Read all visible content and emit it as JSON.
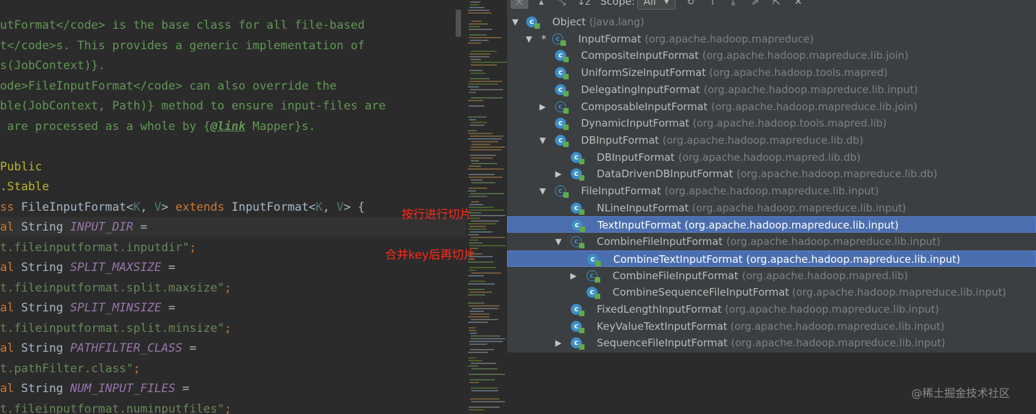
{
  "editor": {
    "lines": [
      [
        [
          "c-doc",
          "utFormat</code> is the base class for all file-based"
        ]
      ],
      [
        [
          "c-doc",
          "t</code>s. This provides a generic implementation of"
        ]
      ],
      [
        [
          "c-doc",
          "s(JobContext)}."
        ]
      ],
      [
        [
          "c-doc",
          "ode>FileInputFormat</code> can also override the"
        ]
      ],
      [
        [
          "c-doc",
          "ble(JobContext, Path)} method to ensure input-files are"
        ]
      ],
      [
        [
          "c-doc",
          " are processed as a whole by {"
        ],
        [
          "c-tag",
          "@link"
        ],
        [
          "c-doc",
          " Mapper}s."
        ]
      ],
      [
        [
          "c-def",
          ""
        ]
      ],
      [
        [
          "c-ann",
          "Public"
        ]
      ],
      [
        [
          "c-ann",
          ".Stable"
        ]
      ],
      [
        [
          "c-kw",
          "ss "
        ],
        [
          "c-def",
          "FileInputFormat<"
        ],
        [
          "c-tp",
          "K"
        ],
        [
          "c-def",
          ", "
        ],
        [
          "c-tp",
          "V"
        ],
        [
          "c-def",
          "> "
        ],
        [
          "c-kw",
          "extends "
        ],
        [
          "c-def",
          "InputFormat<"
        ],
        [
          "c-tp",
          "K"
        ],
        [
          "c-def",
          ", "
        ],
        [
          "c-tp",
          "V"
        ],
        [
          "c-def",
          "> {"
        ]
      ],
      [
        [
          "c-kw",
          "al "
        ],
        [
          "c-def",
          "String "
        ],
        [
          "c-cst",
          "INPUT_DIR"
        ],
        [
          "c-def",
          " ="
        ]
      ],
      [
        [
          "c-str",
          "t.fileinputformat.inputdir\""
        ],
        [
          "c-kw",
          ";"
        ]
      ],
      [
        [
          "c-kw",
          "al "
        ],
        [
          "c-def",
          "String "
        ],
        [
          "c-cst",
          "SPLIT_MAXSIZE"
        ],
        [
          "c-def",
          " ="
        ]
      ],
      [
        [
          "c-str",
          "t.fileinputformat.split.maxsize\""
        ],
        [
          "c-kw",
          ";"
        ]
      ],
      [
        [
          "c-kw",
          "al "
        ],
        [
          "c-def",
          "String "
        ],
        [
          "c-cst",
          "SPLIT_MINSIZE"
        ],
        [
          "c-def",
          " ="
        ]
      ],
      [
        [
          "c-str",
          "t.fileinputformat.split.minsize\""
        ],
        [
          "c-kw",
          ";"
        ]
      ],
      [
        [
          "c-kw",
          "al "
        ],
        [
          "c-def",
          "String "
        ],
        [
          "c-cst",
          "PATHFILTER_CLASS"
        ],
        [
          "c-def",
          " ="
        ]
      ],
      [
        [
          "c-str",
          "t.pathFilter.class\""
        ],
        [
          "c-kw",
          ";"
        ]
      ],
      [
        [
          "c-kw",
          "al "
        ],
        [
          "c-def",
          "String "
        ],
        [
          "c-cst",
          "NUM_INPUT_FILES"
        ],
        [
          "c-def",
          " ="
        ]
      ],
      [
        [
          "c-str",
          "t.fileinputformat.numinputfiles\""
        ],
        [
          "c-kw",
          ";"
        ]
      ]
    ]
  },
  "toolbar": {
    "scope_label": "Scope:",
    "scope_value": "All",
    "icons": [
      "class-hierarchy-icon",
      "supertypes-icon",
      "subtypes-icon",
      "sort-alpha-icon",
      "refresh-icon",
      "scroll-up-icon",
      "scroll-down-icon",
      "pin-icon",
      "export-icon",
      "close-icon"
    ]
  },
  "tree": [
    {
      "depth": 0,
      "expand": "open",
      "abstract": false,
      "star": false,
      "name": "Object",
      "pkg": "(java.lang)",
      "selected": false
    },
    {
      "depth": 1,
      "expand": "open",
      "abstract": true,
      "star": true,
      "name": "InputFormat",
      "pkg": "(org.apache.hadoop.mapreduce)",
      "selected": false
    },
    {
      "depth": 2,
      "expand": "none",
      "abstract": false,
      "star": false,
      "name": "CompositeInputFormat",
      "pkg": "(org.apache.hadoop.mapreduce.lib.join)",
      "selected": false
    },
    {
      "depth": 2,
      "expand": "none",
      "abstract": false,
      "star": false,
      "name": "UniformSizeInputFormat",
      "pkg": "(org.apache.hadoop.tools.mapred)",
      "selected": false
    },
    {
      "depth": 2,
      "expand": "none",
      "abstract": false,
      "star": false,
      "name": "DelegatingInputFormat",
      "pkg": "(org.apache.hadoop.mapreduce.lib.input)",
      "selected": false
    },
    {
      "depth": 2,
      "expand": "closed",
      "abstract": true,
      "star": false,
      "name": "ComposableInputFormat",
      "pkg": "(org.apache.hadoop.mapreduce.lib.join)",
      "selected": false
    },
    {
      "depth": 2,
      "expand": "none",
      "abstract": false,
      "star": false,
      "name": "DynamicInputFormat",
      "pkg": "(org.apache.hadoop.tools.mapred.lib)",
      "selected": false
    },
    {
      "depth": 2,
      "expand": "open",
      "abstract": false,
      "star": false,
      "name": "DBInputFormat",
      "pkg": "(org.apache.hadoop.mapreduce.lib.db)",
      "selected": false
    },
    {
      "depth": 3,
      "expand": "none",
      "abstract": false,
      "star": false,
      "name": "DBInputFormat",
      "pkg": "(org.apache.hadoop.mapred.lib.db)",
      "selected": false
    },
    {
      "depth": 3,
      "expand": "closed",
      "abstract": false,
      "star": false,
      "name": "DataDrivenDBInputFormat",
      "pkg": "(org.apache.hadoop.mapreduce.lib.db)",
      "selected": false
    },
    {
      "depth": 2,
      "expand": "open",
      "abstract": true,
      "star": false,
      "name": "FileInputFormat",
      "pkg": "(org.apache.hadoop.mapreduce.lib.input)",
      "selected": false
    },
    {
      "depth": 3,
      "expand": "none",
      "abstract": false,
      "star": false,
      "name": "NLineInputFormat",
      "pkg": "(org.apache.hadoop.mapreduce.lib.input)",
      "selected": false
    },
    {
      "depth": 3,
      "expand": "none",
      "abstract": false,
      "star": false,
      "name": "TextInputFormat",
      "pkg": "(org.apache.hadoop.mapreduce.lib.input)",
      "selected": true
    },
    {
      "depth": 3,
      "expand": "open",
      "abstract": true,
      "star": false,
      "name": "CombineFileInputFormat",
      "pkg": "(org.apache.hadoop.mapreduce.lib.input)",
      "selected": false
    },
    {
      "depth": 4,
      "expand": "none",
      "abstract": false,
      "star": false,
      "name": "CombineTextInputFormat",
      "pkg": "(org.apache.hadoop.mapreduce.lib.input)",
      "selected": true
    },
    {
      "depth": 4,
      "expand": "closed",
      "abstract": true,
      "star": false,
      "name": "CombineFileInputFormat",
      "pkg": "(org.apache.hadoop.mapred.lib)",
      "selected": false
    },
    {
      "depth": 4,
      "expand": "none",
      "abstract": false,
      "star": false,
      "name": "CombineSequenceFileInputFormat",
      "pkg": "(org.apache.hadoop.mapreduce.lib.input)",
      "selected": false
    },
    {
      "depth": 3,
      "expand": "none",
      "abstract": false,
      "star": false,
      "name": "FixedLengthInputFormat",
      "pkg": "(org.apache.hadoop.mapreduce.lib.input)",
      "selected": false
    },
    {
      "depth": 3,
      "expand": "none",
      "abstract": false,
      "star": false,
      "name": "KeyValueTextInputFormat",
      "pkg": "(org.apache.hadoop.mapreduce.lib.input)",
      "selected": false
    },
    {
      "depth": 3,
      "expand": "closed",
      "abstract": false,
      "star": false,
      "name": "SequenceFileInputFormat",
      "pkg": "(org.apache.hadoop.mapreduce.lib.input)",
      "selected": false
    }
  ],
  "annotations": {
    "text_input": "按行进行切片",
    "combine_text": "合并key后再切片"
  },
  "watermark": "@稀土掘金技术社区",
  "colors": {
    "selection": "#4b6eaf",
    "class_icon": "#3d8ec8",
    "annotation": "#ff2a1a"
  }
}
